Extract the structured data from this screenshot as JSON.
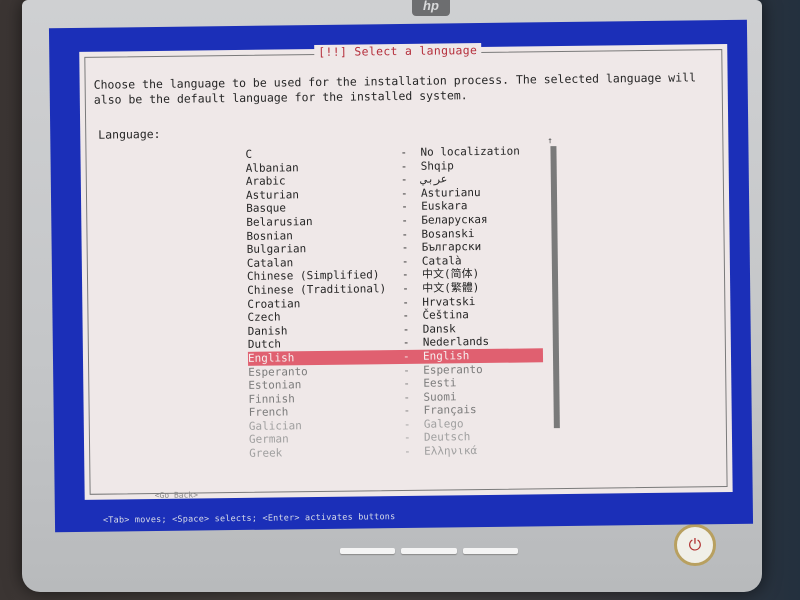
{
  "brand": {
    "logo_text": "hp"
  },
  "dialog": {
    "title": "[!!] Select a language",
    "description": "Choose the language to be used for the installation process. The selected language will also be the default language for the installed system.",
    "field_label": "Language:",
    "languages": [
      {
        "name": "C",
        "native": "No localization"
      },
      {
        "name": "Albanian",
        "native": "Shqip"
      },
      {
        "name": "Arabic",
        "native": "عربي"
      },
      {
        "name": "Asturian",
        "native": "Asturianu"
      },
      {
        "name": "Basque",
        "native": "Euskara"
      },
      {
        "name": "Belarusian",
        "native": "Беларуская"
      },
      {
        "name": "Bosnian",
        "native": "Bosanski"
      },
      {
        "name": "Bulgarian",
        "native": "Български"
      },
      {
        "name": "Catalan",
        "native": "Català"
      },
      {
        "name": "Chinese (Simplified)",
        "native": "中文(简体)"
      },
      {
        "name": "Chinese (Traditional)",
        "native": "中文(繁體)"
      },
      {
        "name": "Croatian",
        "native": "Hrvatski"
      },
      {
        "name": "Czech",
        "native": "Čeština"
      },
      {
        "name": "Danish",
        "native": "Dansk"
      },
      {
        "name": "Dutch",
        "native": "Nederlands"
      },
      {
        "name": "English",
        "native": "English"
      },
      {
        "name": "Esperanto",
        "native": "Esperanto"
      },
      {
        "name": "Estonian",
        "native": "Eesti"
      },
      {
        "name": "Finnish",
        "native": "Suomi"
      },
      {
        "name": "French",
        "native": "Français"
      },
      {
        "name": "Galician",
        "native": "Galego"
      },
      {
        "name": "German",
        "native": "Deutsch"
      },
      {
        "name": "Greek",
        "native": "Ελληνικά"
      }
    ],
    "selected_language": "English",
    "go_back_label": "<Go Back>"
  },
  "status_bar": {
    "text": "<Tab> moves; <Space> selects; <Enter> activates buttons"
  },
  "colors": {
    "screen_background": "#1b2fb8",
    "dialog_background": "#efe8e8",
    "title_color": "#b52f3c",
    "selection_color": "#e06070"
  }
}
